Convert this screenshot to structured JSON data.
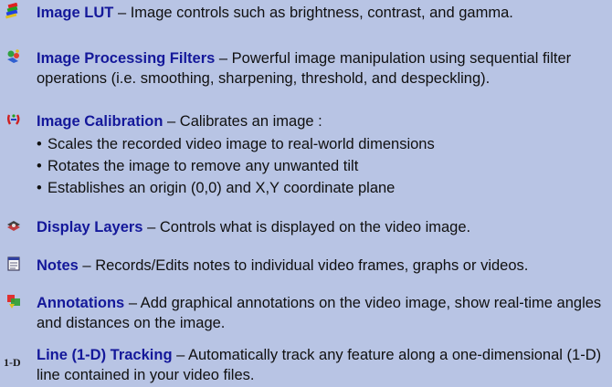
{
  "items": [
    {
      "id": "image-lut",
      "title": "Image LUT",
      "description": " – Image controls such as brightness, contrast, and gamma.",
      "icon": "image-lut-icon"
    },
    {
      "id": "image-processing-filters",
      "title": "Image Processing Filters",
      "description": " – Powerful image manipulation using sequential filter operations (i.e. smoothing, sharpening, threshold, and despeckling).",
      "icon": "filters-icon"
    },
    {
      "id": "image-calibration",
      "title": "Image Calibration",
      "description": " – Calibrates an image :",
      "bullets": [
        "Scales the recorded video image to real-world dimensions",
        "Rotates the image to remove any unwanted tilt",
        "Establishes an origin (0,0) and X,Y coordinate plane"
      ],
      "icon": "calibration-icon"
    },
    {
      "id": "display-layers",
      "title": "Display Layers",
      "description": " – Controls what is displayed on the video image.",
      "icon": "layers-icon"
    },
    {
      "id": "notes",
      "title": "Notes",
      "description": " – Records/Edits notes to individual video frames, graphs or videos.",
      "icon": "notes-icon"
    },
    {
      "id": "annotations",
      "title": "Annotations",
      "description": " – Add graphical annotations on the video image, show real-time angles and distances on the image.",
      "icon": "annotations-icon"
    },
    {
      "id": "line-tracking",
      "title": "Line (1-D) Tracking",
      "description": " – Automatically track any feature along a one-dimensional (1-D) line contained in your video files.",
      "icon": "line-tracking-icon",
      "icon_text": "1-D"
    }
  ]
}
